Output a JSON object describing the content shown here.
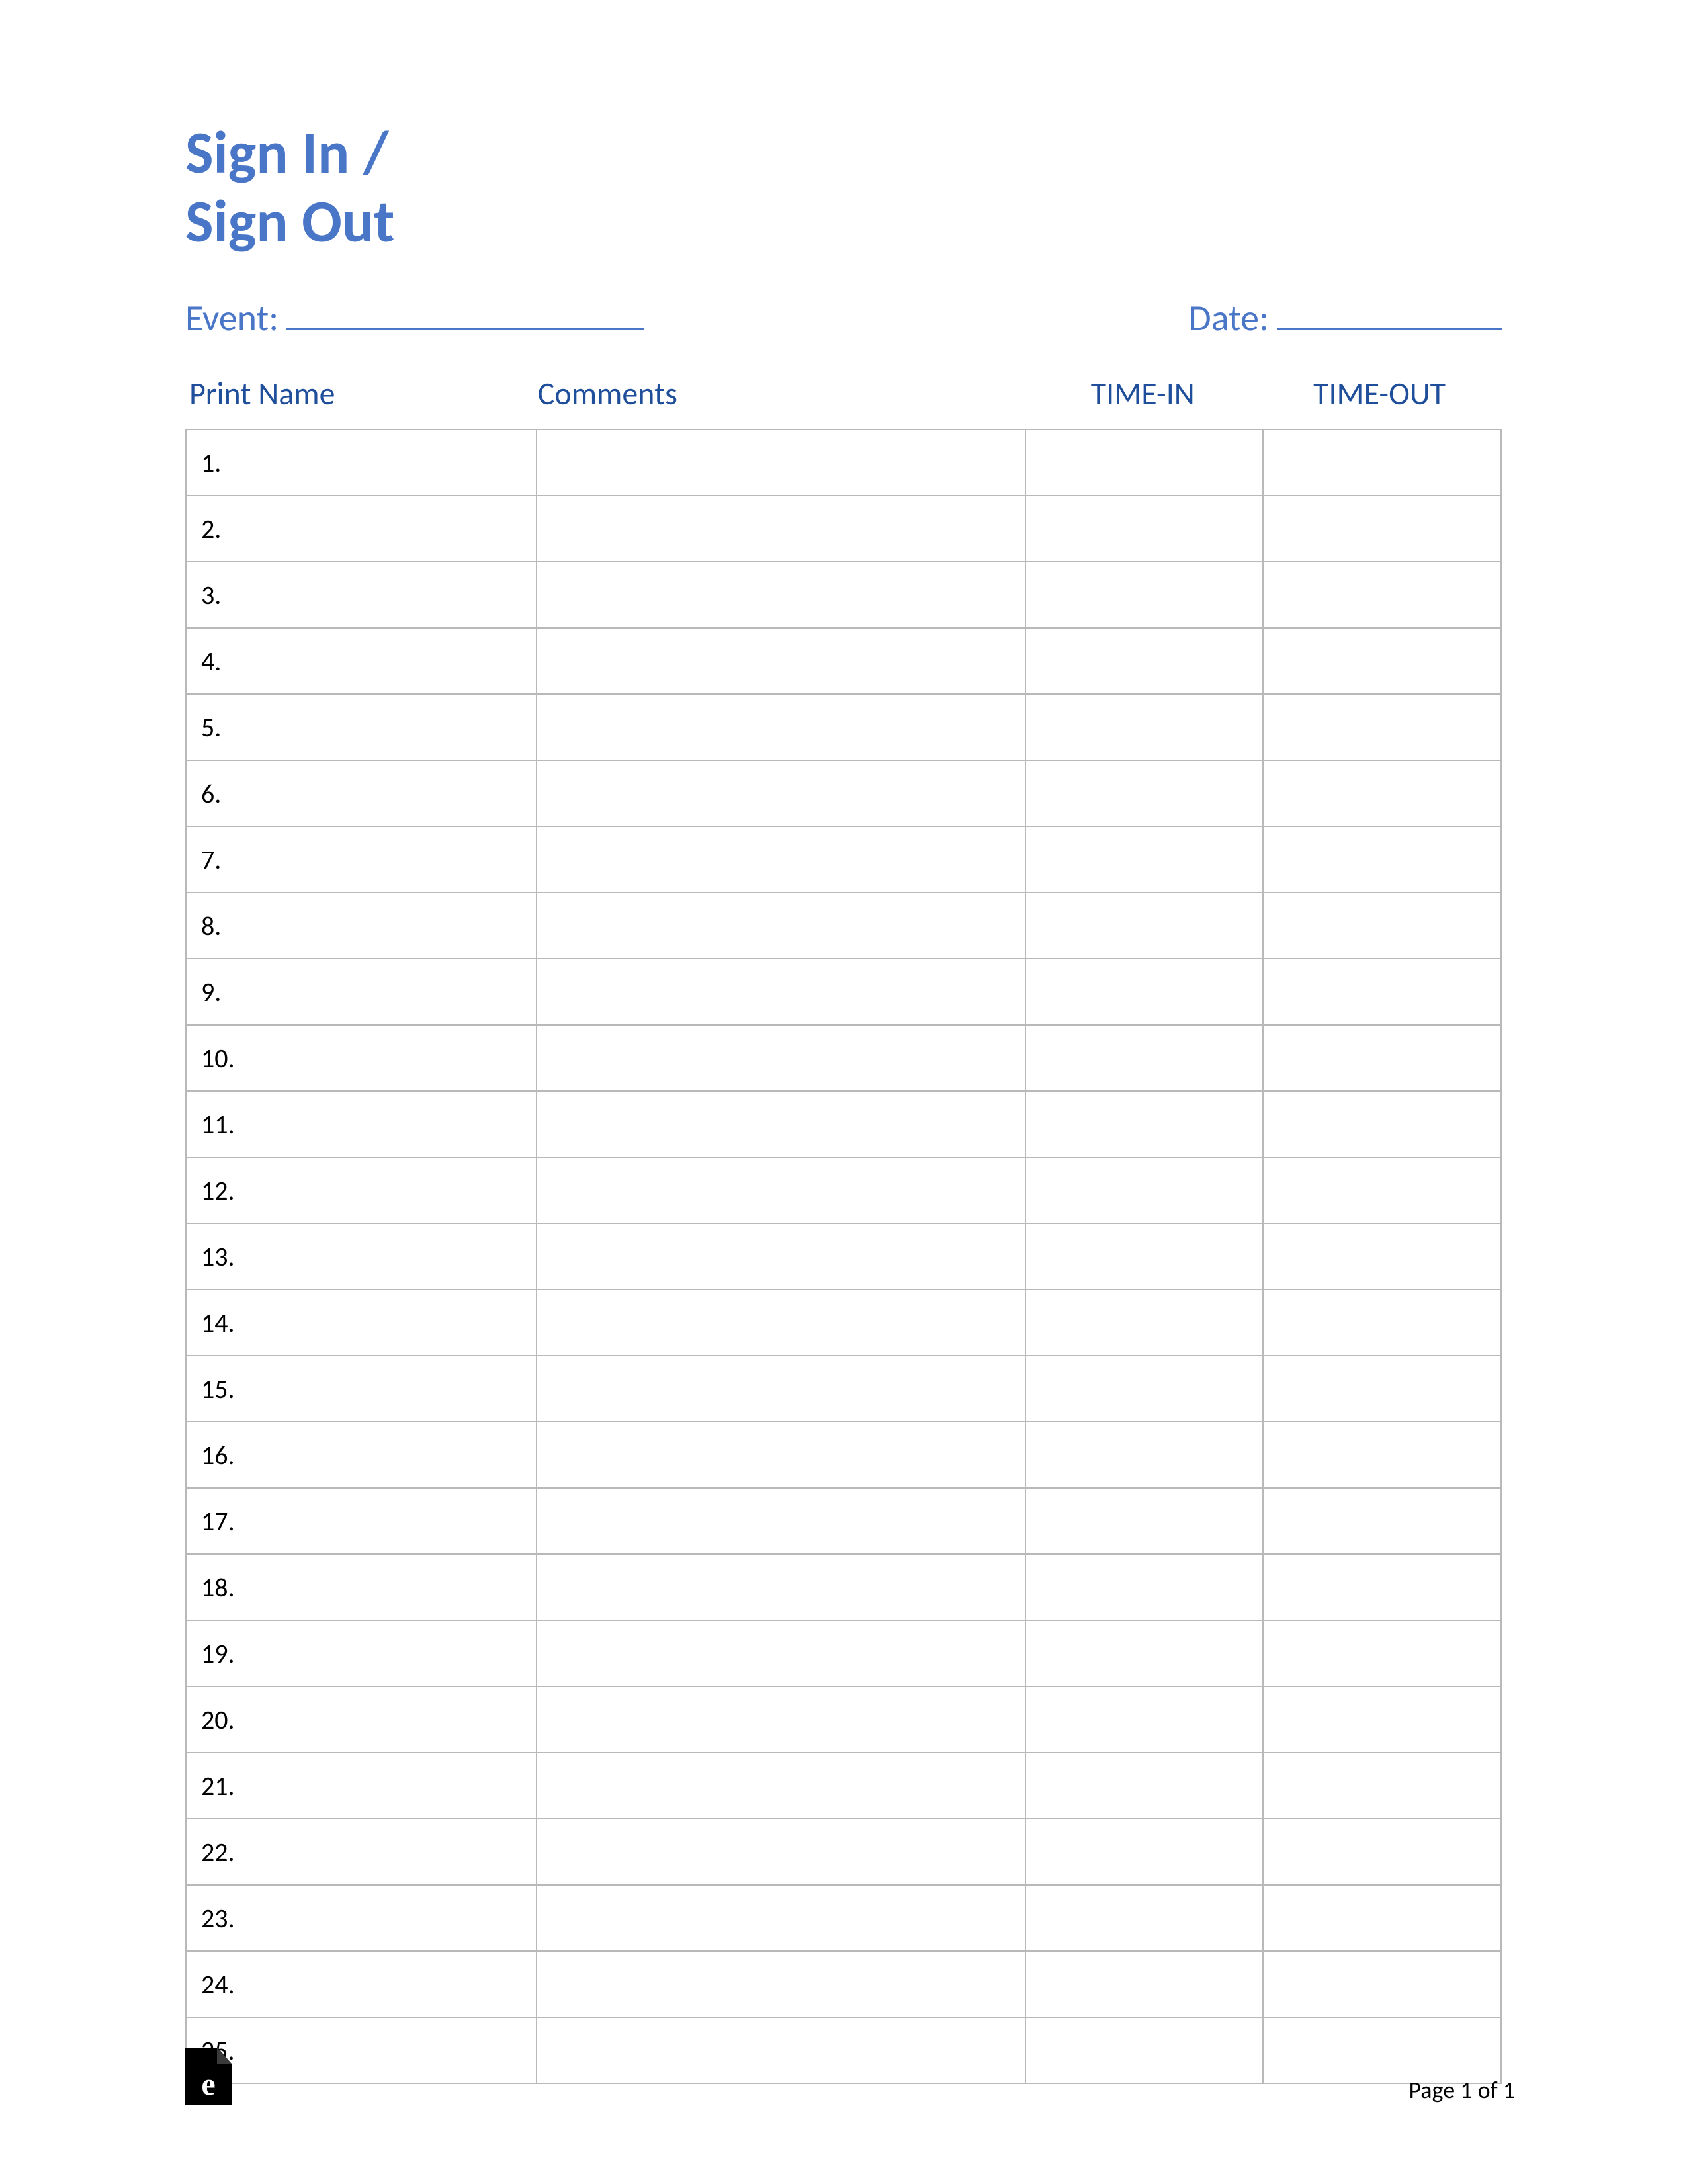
{
  "title_line1": "Sign In /",
  "title_line2": "Sign Out",
  "meta": {
    "event_label": "Event:",
    "date_label": "Date:"
  },
  "columns": {
    "name": "Print Name",
    "comments": "Comments",
    "time_in": "TIME-IN",
    "time_out": "TIME-OUT"
  },
  "rows": [
    {
      "num": "1.",
      "name": "",
      "comments": "",
      "time_in": "",
      "time_out": ""
    },
    {
      "num": "2.",
      "name": "",
      "comments": "",
      "time_in": "",
      "time_out": ""
    },
    {
      "num": "3.",
      "name": "",
      "comments": "",
      "time_in": "",
      "time_out": ""
    },
    {
      "num": "4.",
      "name": "",
      "comments": "",
      "time_in": "",
      "time_out": ""
    },
    {
      "num": "5.",
      "name": "",
      "comments": "",
      "time_in": "",
      "time_out": ""
    },
    {
      "num": "6.",
      "name": "",
      "comments": "",
      "time_in": "",
      "time_out": ""
    },
    {
      "num": "7.",
      "name": "",
      "comments": "",
      "time_in": "",
      "time_out": ""
    },
    {
      "num": "8.",
      "name": "",
      "comments": "",
      "time_in": "",
      "time_out": ""
    },
    {
      "num": "9.",
      "name": "",
      "comments": "",
      "time_in": "",
      "time_out": ""
    },
    {
      "num": "10.",
      "name": "",
      "comments": "",
      "time_in": "",
      "time_out": ""
    },
    {
      "num": "11.",
      "name": "",
      "comments": "",
      "time_in": "",
      "time_out": ""
    },
    {
      "num": "12.",
      "name": "",
      "comments": "",
      "time_in": "",
      "time_out": ""
    },
    {
      "num": "13.",
      "name": "",
      "comments": "",
      "time_in": "",
      "time_out": ""
    },
    {
      "num": "14.",
      "name": "",
      "comments": "",
      "time_in": "",
      "time_out": ""
    },
    {
      "num": "15.",
      "name": "",
      "comments": "",
      "time_in": "",
      "time_out": ""
    },
    {
      "num": "16.",
      "name": "",
      "comments": "",
      "time_in": "",
      "time_out": ""
    },
    {
      "num": "17.",
      "name": "",
      "comments": "",
      "time_in": "",
      "time_out": ""
    },
    {
      "num": "18.",
      "name": "",
      "comments": "",
      "time_in": "",
      "time_out": ""
    },
    {
      "num": "19.",
      "name": "",
      "comments": "",
      "time_in": "",
      "time_out": ""
    },
    {
      "num": "20.",
      "name": "",
      "comments": "",
      "time_in": "",
      "time_out": ""
    },
    {
      "num": "21.",
      "name": "",
      "comments": "",
      "time_in": "",
      "time_out": ""
    },
    {
      "num": "22.",
      "name": "",
      "comments": "",
      "time_in": "",
      "time_out": ""
    },
    {
      "num": "23.",
      "name": "",
      "comments": "",
      "time_in": "",
      "time_out": ""
    },
    {
      "num": "24.",
      "name": "",
      "comments": "",
      "time_in": "",
      "time_out": ""
    },
    {
      "num": "25.",
      "name": "",
      "comments": "",
      "time_in": "",
      "time_out": ""
    }
  ],
  "footer": {
    "logo_letter": "e",
    "page_label": "Page 1 of 1"
  }
}
